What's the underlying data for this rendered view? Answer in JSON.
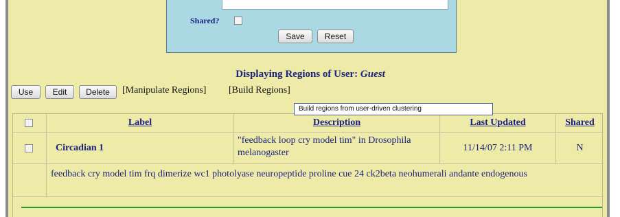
{
  "form": {
    "shared_label": "Shared?",
    "save_label": "Save",
    "reset_label": "Reset"
  },
  "heading": {
    "prefix": "Displaying Regions of User:",
    "user": "Guest"
  },
  "toolbar": {
    "use_label": "Use",
    "edit_label": "Edit",
    "delete_label": "Delete",
    "manipulate_link": "[Manipulate Regions]",
    "build_link": "[Build Regions]"
  },
  "tooltip": {
    "text": "Build regions from user-driven clustering"
  },
  "table": {
    "headers": {
      "label": "Label",
      "description": "Description",
      "last_updated": "Last Updated",
      "shared": "Shared"
    },
    "rows": [
      {
        "label": "Circadian 1",
        "description": "\"feedback loop cry model tim\" in Drosophila melanogaster",
        "last_updated": "11/14/07 2:11 PM",
        "shared": "N",
        "keywords": "feedback cry model tim frq dimerize wc1 photolyase neuropeptide proline cue 24 ck2beta neohumerali andante endogenous"
      }
    ]
  },
  "colors": {
    "page_bg": "#eeeaa8",
    "form_bg": "#aad8e3",
    "text_navy": "#1a237e",
    "rule_green": "#2a9a2a"
  }
}
